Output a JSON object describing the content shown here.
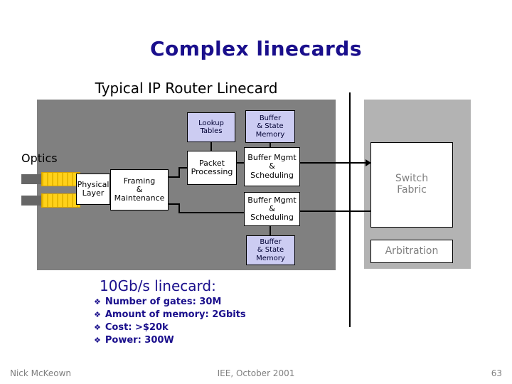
{
  "slide": {
    "title": "Complex linecards",
    "subtitle": "Typical IP Router Linecard",
    "optics_label": "Optics"
  },
  "diagram": {
    "boxes": {
      "physical_layer": "Physical\nLayer",
      "framing": "Framing\n&\nMaintenance",
      "lookup_tables": "Lookup\nTables",
      "packet_processing": "Packet\nProcessing",
      "buffer_state_memory_top": "Buffer\n& State\nMemory",
      "buffer_mgmt_top": "Buffer Mgmt\n&\nScheduling",
      "buffer_mgmt_bottom": "Buffer Mgmt\n&\nScheduling",
      "buffer_state_memory_bottom": "Buffer\n& State\nMemory",
      "switch_fabric": "Switch\nFabric",
      "arbitration": "Arbitration"
    }
  },
  "specs": {
    "heading": "10Gb/s linecard:",
    "bullet_glyph": "❖",
    "items": [
      "Number of gates: 30M",
      "Amount of memory: 2Gbits",
      "Cost: >$20k",
      "Power: 300W"
    ]
  },
  "footer": {
    "author": "Nick McKeown",
    "venue": "IEE, October 2001",
    "page": "63"
  },
  "colors": {
    "title_blue": "#1a0f8c",
    "panel_dark": "#808080",
    "panel_light": "#b3b3b3",
    "memory_box": "#ccccf2",
    "fabric_text": "#808080",
    "connector_yellow": "#ffcc00"
  }
}
